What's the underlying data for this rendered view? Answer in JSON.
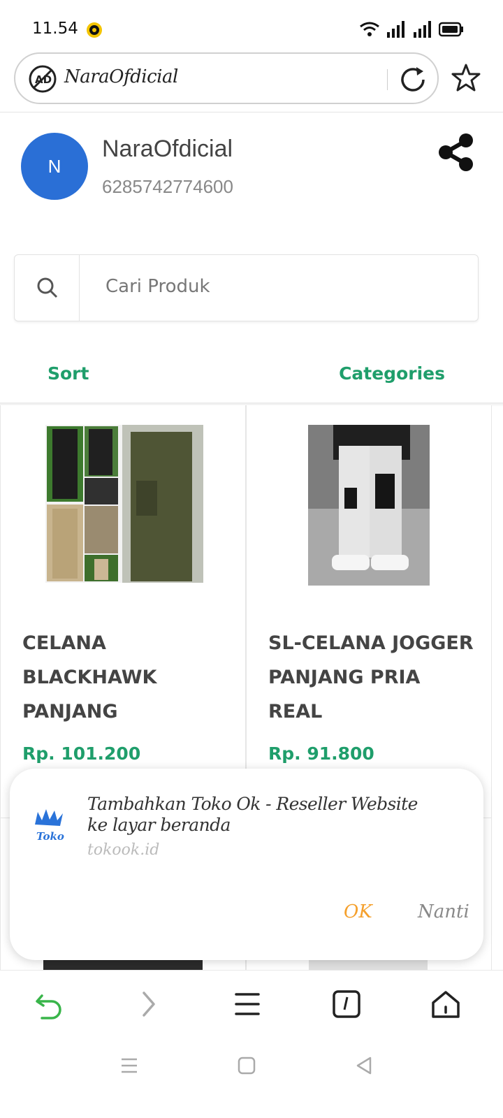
{
  "status_bar": {
    "time": "11.54"
  },
  "browser": {
    "url": "NaraOfdicial",
    "icons": [
      "adblock-icon",
      "reload-icon",
      "star-icon"
    ]
  },
  "shop": {
    "avatar_letter": "N",
    "name": "NaraOfdicial",
    "phone": "6285742774600"
  },
  "search": {
    "placeholder": "Cari Produk"
  },
  "filters": {
    "sort_label": "Sort",
    "categories_label": "Categories"
  },
  "products": [
    {
      "title": "CELANA BLACKHAWK PANJANG",
      "price": "Rp. 101.200"
    },
    {
      "title": "SL-CELANA JOGGER PANJANG PRIA REAL",
      "price": "Rp. 91.800"
    }
  ],
  "install_prompt": {
    "title": "Tambahkan Toko Ok - Reseller Website ke layar beranda",
    "domain": "tokook.id",
    "ok_label": "OK",
    "later_label": "Nanti"
  },
  "colors": {
    "accent_green": "#1f9e6b",
    "avatar_blue": "#2a6fd6",
    "ok_orange": "#f5a02c",
    "back_green": "#39b54a"
  }
}
